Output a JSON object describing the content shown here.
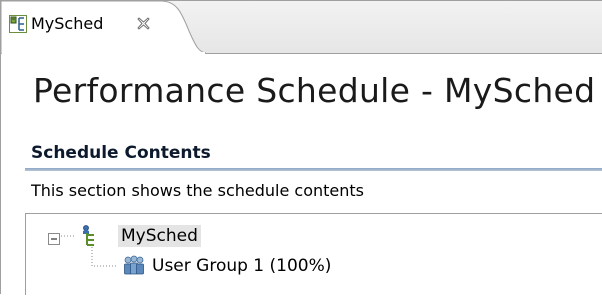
{
  "editor": {
    "tab": {
      "title": "MySched",
      "icon": "schedule-icon",
      "close_icon": "close-icon"
    },
    "title": "Performance Schedule - MySched",
    "section": {
      "title": "Schedule Contents",
      "description": "This section shows the schedule contents"
    },
    "tree": {
      "root": {
        "label": "MySched",
        "icon": "schedule-icon",
        "expander": "collapse-icon",
        "selected": true
      },
      "children": [
        {
          "label": "User Group 1 (100%)",
          "icon": "user-group-icon"
        }
      ]
    }
  },
  "colors": {
    "section_title": "#0d1a2d",
    "section_rule": "#8fa6c4",
    "selection": "#e4e4e4",
    "border": "#9f9f9f"
  }
}
